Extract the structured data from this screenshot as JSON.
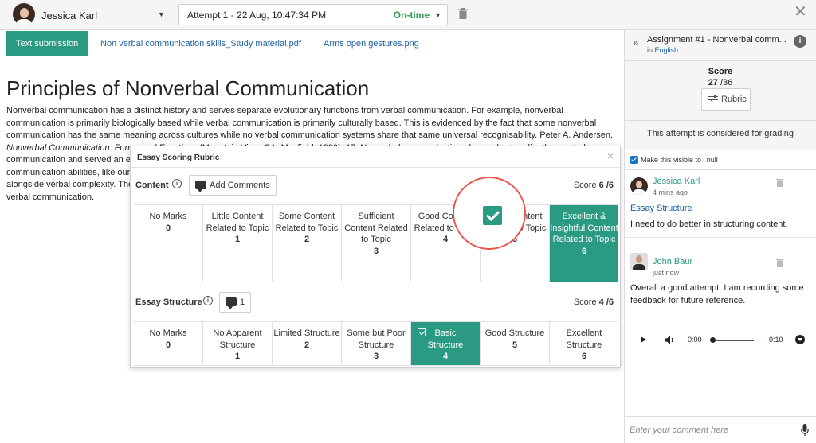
{
  "header": {
    "user_name": "Jessica Karl",
    "attempt_label": "Attempt 1 - 22 Aug, 10:47:34 PM",
    "attempt_status": "On-time",
    "status_color": "#2e9e4f"
  },
  "tabs": [
    {
      "label": "Text submission",
      "active": true
    },
    {
      "label": "Non verbal communication skills_Study material.pdf",
      "active": false
    },
    {
      "label": "Arms open gestures.png",
      "active": false
    }
  ],
  "document": {
    "title": "Principles of Nonverbal Communication",
    "para_1": "Nonverbal communication has a distinct history and serves separate evolutionary functions from verbal communication. For example, nonverbal communication is primarily biologically based while verbal communication is primarily culturally based. This is evidenced by the fact that some nonverbal communication has the same meaning across cultures while no verbal communication systems share that same universal recognisability. Peter A. Andersen,",
    "para_italic": "Nonverbal Communication: Forms and Functions",
    "para_2": "(Mountain View, CA: Mayfield, 1999), 17. Nonverbal communication also evolved earlier than verbal",
    "line_5": "communication and served an e",
    "line_6": "communication abilities, like our",
    "line_7": "alongside verbal complexity. The",
    "line_8": "verbal communication."
  },
  "rubric": {
    "title": "Essay Scoring Rubric",
    "close": "×",
    "criteria": [
      {
        "name": "Content",
        "button_label": "Add Comments",
        "score_label": "Score",
        "score_value": "6 /6",
        "levels": [
          {
            "label": "No Marks",
            "points": "0",
            "selected": false
          },
          {
            "label": "Little Content Related to Topic",
            "points": "1",
            "selected": false
          },
          {
            "label": "Some Content Related to Topic",
            "points": "2",
            "selected": false
          },
          {
            "label": "Sufficient Content Related to Topic",
            "points": "3",
            "selected": false
          },
          {
            "label": "Good Content Related to Topic",
            "points": "4",
            "selected": false
          },
          {
            "label": "Great Content Related to Topic",
            "points": "5",
            "selected": false
          },
          {
            "label": "Excellent & Insightful Content Related to Topic",
            "points": "6",
            "selected": true
          }
        ]
      },
      {
        "name": "Essay Structure",
        "button_label": "1",
        "score_label": "Score",
        "score_value": "4 /6",
        "levels": [
          {
            "label": "No Marks",
            "points": "0",
            "selected": false
          },
          {
            "label": "No Apparent Structure",
            "points": "1",
            "selected": false
          },
          {
            "label": "Limited Structure",
            "points": "2",
            "selected": false
          },
          {
            "label": "Some but Poor Structure",
            "points": "3",
            "selected": false
          },
          {
            "label": "Basic Structure",
            "points": "4",
            "selected": true
          },
          {
            "label": "Good Structure",
            "points": "5",
            "selected": false
          },
          {
            "label": "Excellent Structure",
            "points": "6",
            "selected": false
          }
        ]
      }
    ]
  },
  "panel": {
    "assignment_title": "Assignment #1 - Nonverbal comm...",
    "language_prefix": "in",
    "language": "English",
    "score_label": "Score",
    "score_value": "27",
    "score_total": "/36",
    "rubric_button": "Rubric",
    "grading_note": "This attempt is considered for grading",
    "visibility_label": "Make this visible to ' null"
  },
  "comments": [
    {
      "author": "Jessica Karl",
      "time": "4 mins ago",
      "link": "Essay Structure",
      "text": "I need to do better in structuring content."
    },
    {
      "author": "John Baur",
      "time": "just now",
      "text": "Overall a good attempt. I am recording some feedback for future reference."
    }
  ],
  "audio": {
    "current_time": "0:00",
    "remaining_time": "-0:10",
    "progress": 0.0
  },
  "comment_input": {
    "placeholder": "Enter your comment here"
  },
  "colors": {
    "accent": "#2a9a82",
    "link": "#1a5fa3",
    "annotation": "#e8594c"
  }
}
